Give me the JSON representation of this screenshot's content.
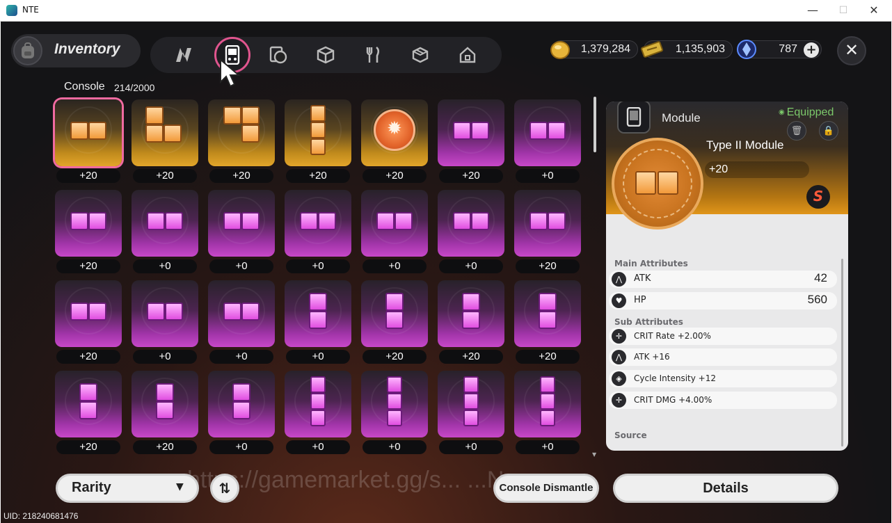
{
  "window": {
    "title": "NTE",
    "min": "—",
    "max": "☐",
    "close": "✕"
  },
  "header": {
    "title": "Inventory",
    "tabs": [
      {
        "icon": "n-logo-icon"
      },
      {
        "icon": "console-icon",
        "active": true
      },
      {
        "icon": "disc-icon"
      },
      {
        "icon": "cube-icon"
      },
      {
        "icon": "utensils-icon"
      },
      {
        "icon": "box-icon"
      },
      {
        "icon": "home-icon"
      }
    ],
    "currencies": [
      {
        "name": "gold-coin",
        "value": "1,379,284",
        "color": "#e8b53a"
      },
      {
        "name": "ticket",
        "value": "1,135,903",
        "color": "#d9b33c"
      },
      {
        "name": "crystal",
        "value": "787",
        "color": "#3e6ee0"
      }
    ],
    "plus": "+",
    "close": "✕"
  },
  "section": {
    "title": "Console",
    "count": "214/2000"
  },
  "items": [
    {
      "rarity": "gold",
      "shape": "h2",
      "level": "+20",
      "selected": true
    },
    {
      "rarity": "gold",
      "shape": "L",
      "level": "+20"
    },
    {
      "rarity": "gold",
      "shape": "J",
      "level": "+20"
    },
    {
      "rarity": "gold",
      "shape": "v3",
      "level": "+20"
    },
    {
      "rarity": "gold",
      "shape": "coin",
      "level": "+20"
    },
    {
      "rarity": "purple",
      "shape": "h2",
      "level": "+20"
    },
    {
      "rarity": "purple",
      "shape": "h2",
      "level": "+0"
    },
    {
      "rarity": "purple",
      "shape": "h2",
      "level": "+20"
    },
    {
      "rarity": "purple",
      "shape": "h2",
      "level": "+0"
    },
    {
      "rarity": "purple",
      "shape": "h2",
      "level": "+0"
    },
    {
      "rarity": "purple",
      "shape": "h2",
      "level": "+0"
    },
    {
      "rarity": "purple",
      "shape": "h2",
      "level": "+0"
    },
    {
      "rarity": "purple",
      "shape": "h2",
      "level": "+0"
    },
    {
      "rarity": "purple",
      "shape": "h2",
      "level": "+20"
    },
    {
      "rarity": "purple",
      "shape": "h2",
      "level": "+20"
    },
    {
      "rarity": "purple",
      "shape": "h2",
      "level": "+0"
    },
    {
      "rarity": "purple",
      "shape": "h2",
      "level": "+0"
    },
    {
      "rarity": "purple",
      "shape": "v2",
      "level": "+0"
    },
    {
      "rarity": "purple",
      "shape": "v2",
      "level": "+20"
    },
    {
      "rarity": "purple",
      "shape": "v2",
      "level": "+20"
    },
    {
      "rarity": "purple",
      "shape": "v2",
      "level": "+20"
    },
    {
      "rarity": "purple",
      "shape": "v2",
      "level": "+20"
    },
    {
      "rarity": "purple",
      "shape": "v2",
      "level": "+20"
    },
    {
      "rarity": "purple",
      "shape": "v2",
      "level": "+0"
    },
    {
      "rarity": "purple",
      "shape": "v3",
      "level": "+0"
    },
    {
      "rarity": "purple",
      "shape": "v3",
      "level": "+0"
    },
    {
      "rarity": "purple",
      "shape": "v3",
      "level": "+0"
    },
    {
      "rarity": "purple",
      "shape": "v3",
      "level": "+0"
    }
  ],
  "detail": {
    "category": "Module",
    "status": "Equipped",
    "name": "Type II Module",
    "level": "+20",
    "set_badge": "S",
    "main_header": "Main Attributes",
    "main": [
      {
        "icon": "atk-icon",
        "name": "ATK",
        "value": "42"
      },
      {
        "icon": "hp-icon",
        "name": "HP",
        "value": "560"
      }
    ],
    "sub_header": "Sub Attributes",
    "sub": [
      {
        "icon": "crit-icon",
        "text": "CRIT Rate +2.00%"
      },
      {
        "icon": "atk-icon",
        "text": "ATK +16"
      },
      {
        "icon": "cycle-icon",
        "text": "Cycle Intensity +12"
      },
      {
        "icon": "crit-icon",
        "text": "CRIT DMG +4.00%"
      }
    ],
    "source_header": "Source"
  },
  "footer": {
    "rarity": "Rarity",
    "sort": "⇅",
    "dismantle": "Console Dismantle",
    "details": "Details",
    "uid": "UID: 218240681476",
    "watermark": "https://gamemarket.gg/s...                   ...News"
  }
}
